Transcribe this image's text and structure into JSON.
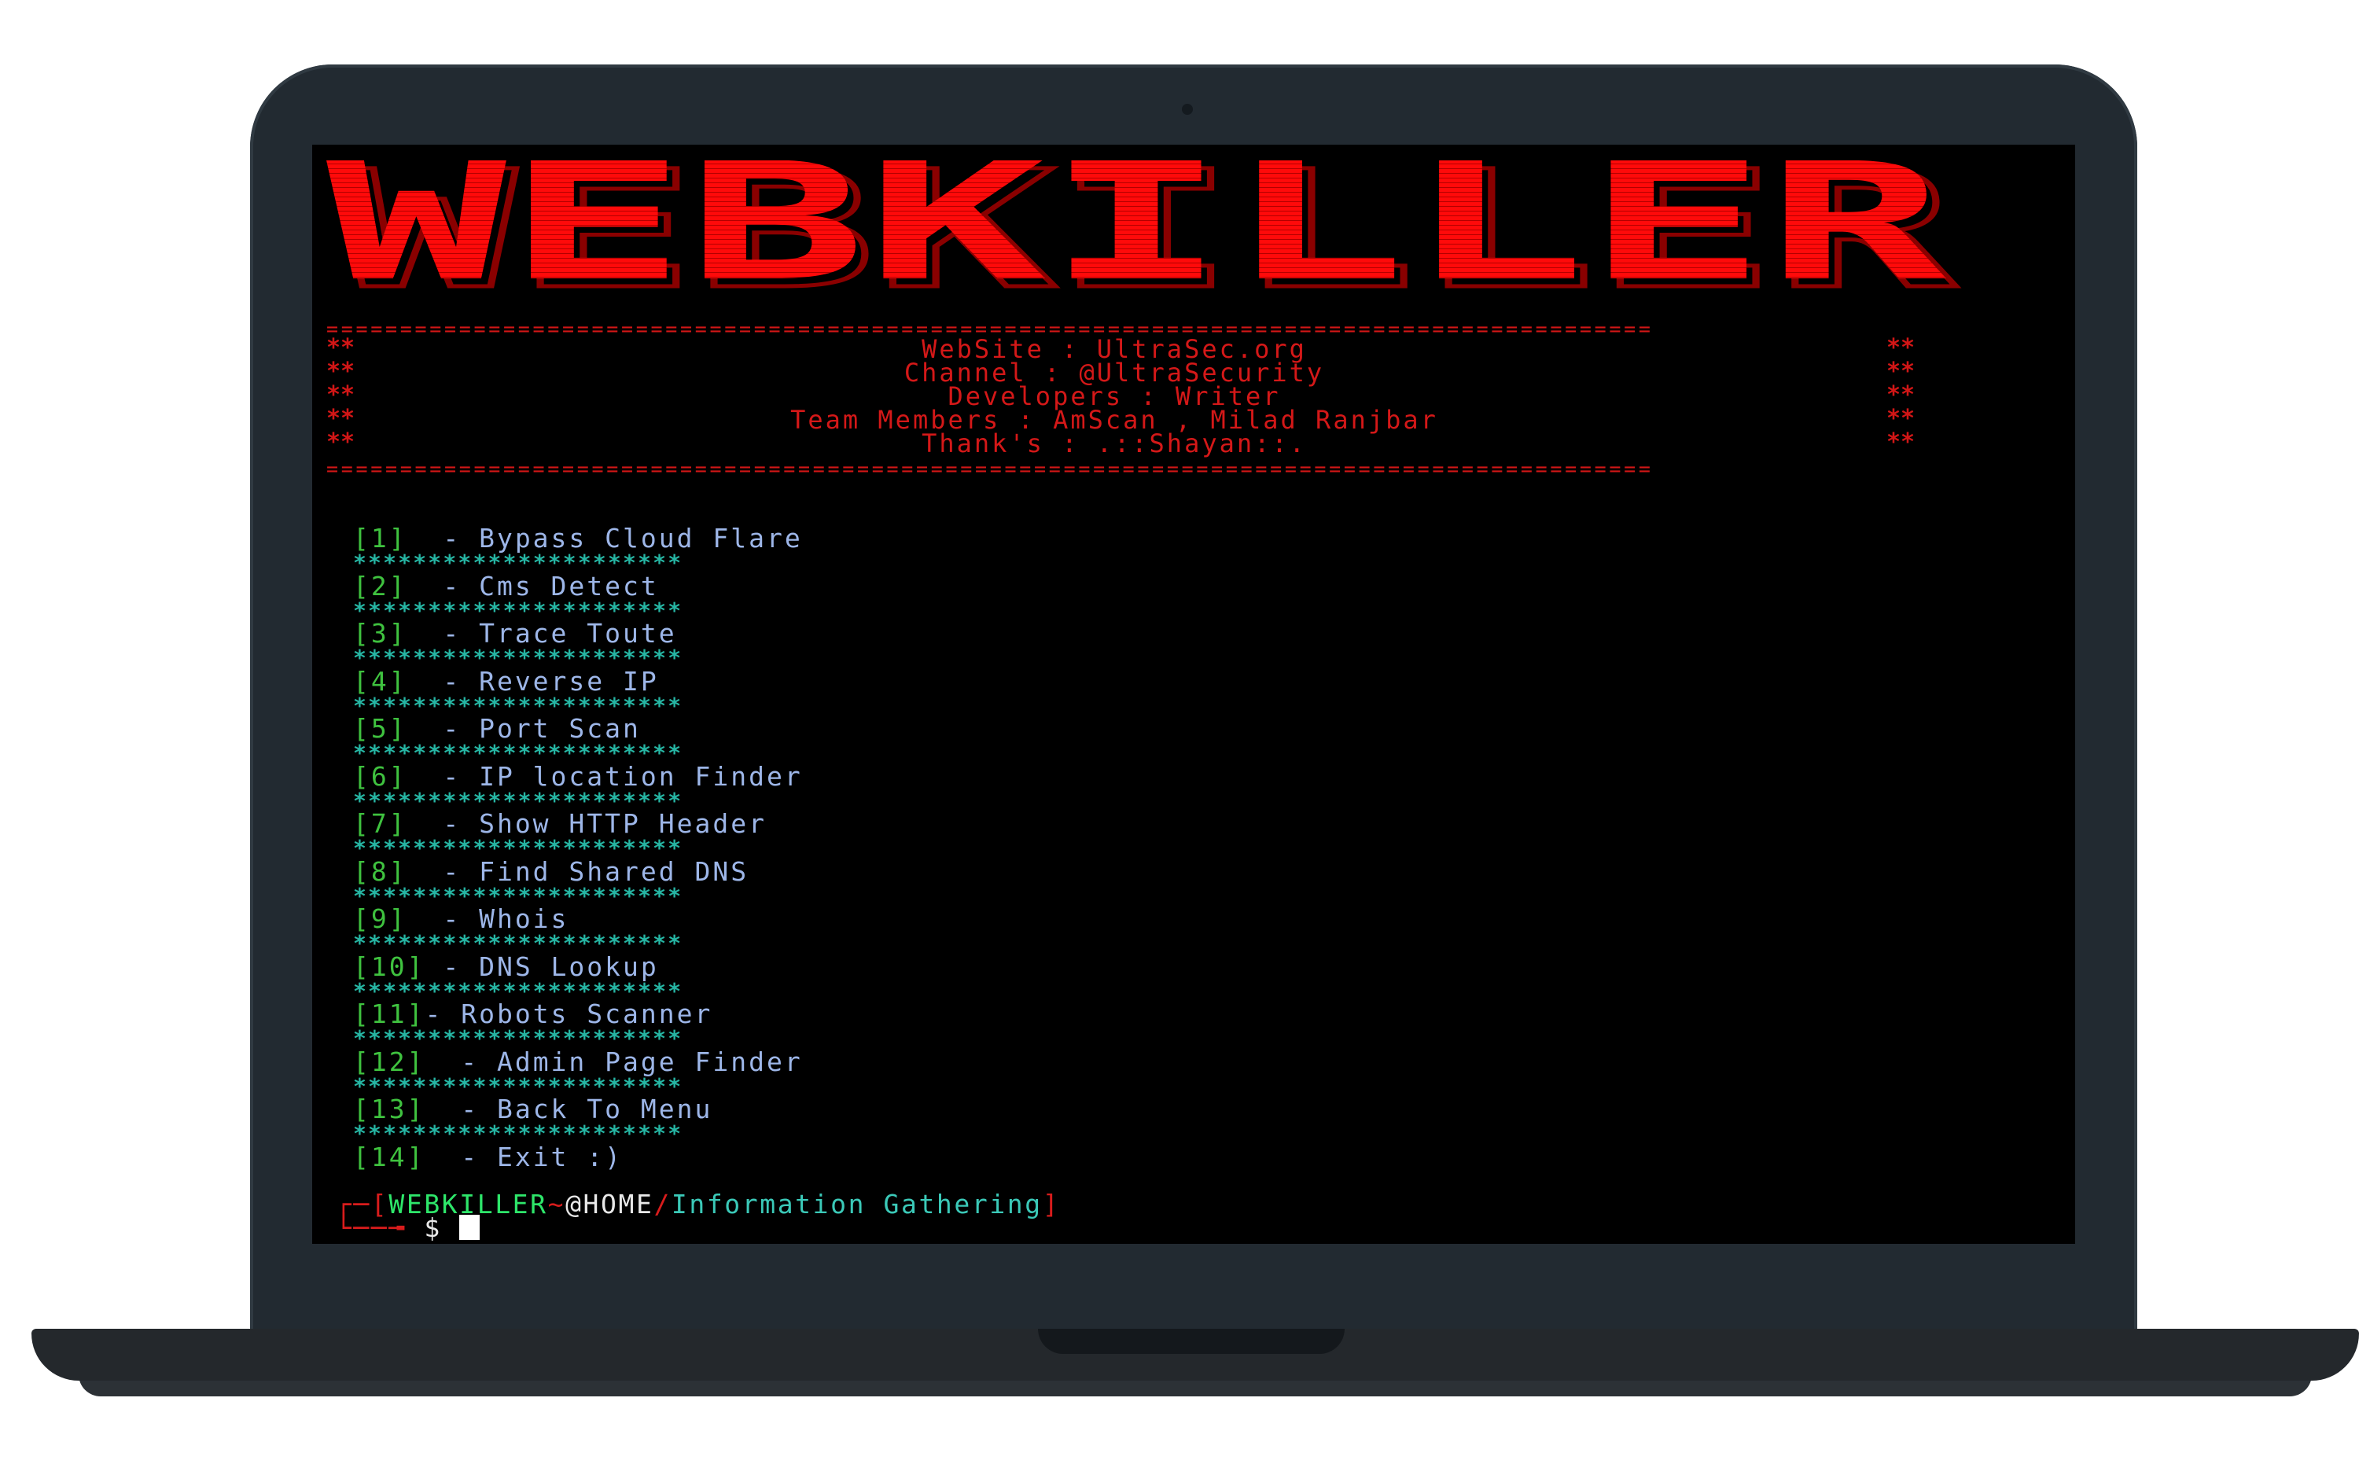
{
  "logo": {
    "text": "WEBKILLER",
    "color": "#ff0a0a"
  },
  "header": {
    "rule": "==========================================================================================",
    "stars_left": "**",
    "stars_right": "**",
    "lines": [
      "WebSite : UltraSec.org",
      "Channel : @UltraSecurity",
      "Developers : Writer",
      "Team Members : AmScan , Milad Ranjbar",
      "Thank's : .::Shayan::."
    ]
  },
  "menu": {
    "separator": "**********************",
    "items": [
      {
        "num": "[1]",
        "label": "  - Bypass Cloud Flare"
      },
      {
        "num": "[2]",
        "label": "  - Cms Detect"
      },
      {
        "num": "[3]",
        "label": "  - Trace Toute"
      },
      {
        "num": "[4]",
        "label": "  - Reverse IP"
      },
      {
        "num": "[5]",
        "label": "  - Port Scan"
      },
      {
        "num": "[6]",
        "label": "  - IP location Finder"
      },
      {
        "num": "[7]",
        "label": "  - Show HTTP Header"
      },
      {
        "num": "[8]",
        "label": "  - Find Shared DNS"
      },
      {
        "num": "[9]",
        "label": "  - Whois"
      },
      {
        "num": "[10]",
        "label": " - DNS Lookup"
      },
      {
        "num": "[11]",
        "label": "- Robots Scanner"
      },
      {
        "num": "[12]",
        "label": "  - Admin Page Finder"
      },
      {
        "num": "[13]",
        "label": "  - Back To Menu"
      },
      {
        "num": "[14]",
        "label": "  - Exit :)"
      }
    ]
  },
  "prompt": {
    "corner_top": "┌─[",
    "user": "WEBKILLER",
    "tilde": "~",
    "host": "@HOME",
    "slash": "/",
    "path": "Information Gathering",
    "close": "]",
    "corner_bottom": "└──╼ ",
    "symbol": "$"
  },
  "colors": {
    "menu_number": "#3fc23f",
    "menu_label": "#9db6e8",
    "separator": "#26b5a3",
    "header_text": "#d41818"
  }
}
